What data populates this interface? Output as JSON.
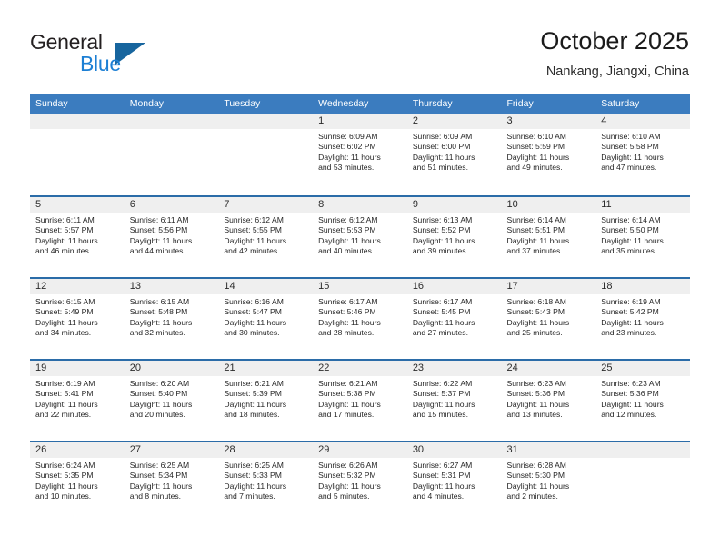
{
  "brand": {
    "name_part1": "General",
    "name_part2": "Blue"
  },
  "header": {
    "title": "October 2025",
    "subtitle": "Nankang, Jiangxi, China"
  },
  "colors": {
    "header_blue": "#3b7cbf",
    "row_divider_blue": "#2b6ca8",
    "daynum_band_gray": "#efefef",
    "brand_blue": "#1c7fd4",
    "brand_triangle": "#17659e"
  },
  "weekdays": [
    "Sunday",
    "Monday",
    "Tuesday",
    "Wednesday",
    "Thursday",
    "Friday",
    "Saturday"
  ],
  "weeks": [
    [
      {
        "day": "",
        "sunrise": "",
        "sunset": "",
        "daylight_line1": "",
        "daylight_line2": "",
        "empty": true
      },
      {
        "day": "",
        "sunrise": "",
        "sunset": "",
        "daylight_line1": "",
        "daylight_line2": "",
        "empty": true
      },
      {
        "day": "",
        "sunrise": "",
        "sunset": "",
        "daylight_line1": "",
        "daylight_line2": "",
        "empty": true
      },
      {
        "day": "1",
        "sunrise": "Sunrise: 6:09 AM",
        "sunset": "Sunset: 6:02 PM",
        "daylight_line1": "Daylight: 11 hours",
        "daylight_line2": "and 53 minutes.",
        "empty": false
      },
      {
        "day": "2",
        "sunrise": "Sunrise: 6:09 AM",
        "sunset": "Sunset: 6:00 PM",
        "daylight_line1": "Daylight: 11 hours",
        "daylight_line2": "and 51 minutes.",
        "empty": false
      },
      {
        "day": "3",
        "sunrise": "Sunrise: 6:10 AM",
        "sunset": "Sunset: 5:59 PM",
        "daylight_line1": "Daylight: 11 hours",
        "daylight_line2": "and 49 minutes.",
        "empty": false
      },
      {
        "day": "4",
        "sunrise": "Sunrise: 6:10 AM",
        "sunset": "Sunset: 5:58 PM",
        "daylight_line1": "Daylight: 11 hours",
        "daylight_line2": "and 47 minutes.",
        "empty": false
      }
    ],
    [
      {
        "day": "5",
        "sunrise": "Sunrise: 6:11 AM",
        "sunset": "Sunset: 5:57 PM",
        "daylight_line1": "Daylight: 11 hours",
        "daylight_line2": "and 46 minutes.",
        "empty": false
      },
      {
        "day": "6",
        "sunrise": "Sunrise: 6:11 AM",
        "sunset": "Sunset: 5:56 PM",
        "daylight_line1": "Daylight: 11 hours",
        "daylight_line2": "and 44 minutes.",
        "empty": false
      },
      {
        "day": "7",
        "sunrise": "Sunrise: 6:12 AM",
        "sunset": "Sunset: 5:55 PM",
        "daylight_line1": "Daylight: 11 hours",
        "daylight_line2": "and 42 minutes.",
        "empty": false
      },
      {
        "day": "8",
        "sunrise": "Sunrise: 6:12 AM",
        "sunset": "Sunset: 5:53 PM",
        "daylight_line1": "Daylight: 11 hours",
        "daylight_line2": "and 40 minutes.",
        "empty": false
      },
      {
        "day": "9",
        "sunrise": "Sunrise: 6:13 AM",
        "sunset": "Sunset: 5:52 PM",
        "daylight_line1": "Daylight: 11 hours",
        "daylight_line2": "and 39 minutes.",
        "empty": false
      },
      {
        "day": "10",
        "sunrise": "Sunrise: 6:14 AM",
        "sunset": "Sunset: 5:51 PM",
        "daylight_line1": "Daylight: 11 hours",
        "daylight_line2": "and 37 minutes.",
        "empty": false
      },
      {
        "day": "11",
        "sunrise": "Sunrise: 6:14 AM",
        "sunset": "Sunset: 5:50 PM",
        "daylight_line1": "Daylight: 11 hours",
        "daylight_line2": "and 35 minutes.",
        "empty": false
      }
    ],
    [
      {
        "day": "12",
        "sunrise": "Sunrise: 6:15 AM",
        "sunset": "Sunset: 5:49 PM",
        "daylight_line1": "Daylight: 11 hours",
        "daylight_line2": "and 34 minutes.",
        "empty": false
      },
      {
        "day": "13",
        "sunrise": "Sunrise: 6:15 AM",
        "sunset": "Sunset: 5:48 PM",
        "daylight_line1": "Daylight: 11 hours",
        "daylight_line2": "and 32 minutes.",
        "empty": false
      },
      {
        "day": "14",
        "sunrise": "Sunrise: 6:16 AM",
        "sunset": "Sunset: 5:47 PM",
        "daylight_line1": "Daylight: 11 hours",
        "daylight_line2": "and 30 minutes.",
        "empty": false
      },
      {
        "day": "15",
        "sunrise": "Sunrise: 6:17 AM",
        "sunset": "Sunset: 5:46 PM",
        "daylight_line1": "Daylight: 11 hours",
        "daylight_line2": "and 28 minutes.",
        "empty": false
      },
      {
        "day": "16",
        "sunrise": "Sunrise: 6:17 AM",
        "sunset": "Sunset: 5:45 PM",
        "daylight_line1": "Daylight: 11 hours",
        "daylight_line2": "and 27 minutes.",
        "empty": false
      },
      {
        "day": "17",
        "sunrise": "Sunrise: 6:18 AM",
        "sunset": "Sunset: 5:43 PM",
        "daylight_line1": "Daylight: 11 hours",
        "daylight_line2": "and 25 minutes.",
        "empty": false
      },
      {
        "day": "18",
        "sunrise": "Sunrise: 6:19 AM",
        "sunset": "Sunset: 5:42 PM",
        "daylight_line1": "Daylight: 11 hours",
        "daylight_line2": "and 23 minutes.",
        "empty": false
      }
    ],
    [
      {
        "day": "19",
        "sunrise": "Sunrise: 6:19 AM",
        "sunset": "Sunset: 5:41 PM",
        "daylight_line1": "Daylight: 11 hours",
        "daylight_line2": "and 22 minutes.",
        "empty": false
      },
      {
        "day": "20",
        "sunrise": "Sunrise: 6:20 AM",
        "sunset": "Sunset: 5:40 PM",
        "daylight_line1": "Daylight: 11 hours",
        "daylight_line2": "and 20 minutes.",
        "empty": false
      },
      {
        "day": "21",
        "sunrise": "Sunrise: 6:21 AM",
        "sunset": "Sunset: 5:39 PM",
        "daylight_line1": "Daylight: 11 hours",
        "daylight_line2": "and 18 minutes.",
        "empty": false
      },
      {
        "day": "22",
        "sunrise": "Sunrise: 6:21 AM",
        "sunset": "Sunset: 5:38 PM",
        "daylight_line1": "Daylight: 11 hours",
        "daylight_line2": "and 17 minutes.",
        "empty": false
      },
      {
        "day": "23",
        "sunrise": "Sunrise: 6:22 AM",
        "sunset": "Sunset: 5:37 PM",
        "daylight_line1": "Daylight: 11 hours",
        "daylight_line2": "and 15 minutes.",
        "empty": false
      },
      {
        "day": "24",
        "sunrise": "Sunrise: 6:23 AM",
        "sunset": "Sunset: 5:36 PM",
        "daylight_line1": "Daylight: 11 hours",
        "daylight_line2": "and 13 minutes.",
        "empty": false
      },
      {
        "day": "25",
        "sunrise": "Sunrise: 6:23 AM",
        "sunset": "Sunset: 5:36 PM",
        "daylight_line1": "Daylight: 11 hours",
        "daylight_line2": "and 12 minutes.",
        "empty": false
      }
    ],
    [
      {
        "day": "26",
        "sunrise": "Sunrise: 6:24 AM",
        "sunset": "Sunset: 5:35 PM",
        "daylight_line1": "Daylight: 11 hours",
        "daylight_line2": "and 10 minutes.",
        "empty": false
      },
      {
        "day": "27",
        "sunrise": "Sunrise: 6:25 AM",
        "sunset": "Sunset: 5:34 PM",
        "daylight_line1": "Daylight: 11 hours",
        "daylight_line2": "and 8 minutes.",
        "empty": false
      },
      {
        "day": "28",
        "sunrise": "Sunrise: 6:25 AM",
        "sunset": "Sunset: 5:33 PM",
        "daylight_line1": "Daylight: 11 hours",
        "daylight_line2": "and 7 minutes.",
        "empty": false
      },
      {
        "day": "29",
        "sunrise": "Sunrise: 6:26 AM",
        "sunset": "Sunset: 5:32 PM",
        "daylight_line1": "Daylight: 11 hours",
        "daylight_line2": "and 5 minutes.",
        "empty": false
      },
      {
        "day": "30",
        "sunrise": "Sunrise: 6:27 AM",
        "sunset": "Sunset: 5:31 PM",
        "daylight_line1": "Daylight: 11 hours",
        "daylight_line2": "and 4 minutes.",
        "empty": false
      },
      {
        "day": "31",
        "sunrise": "Sunrise: 6:28 AM",
        "sunset": "Sunset: 5:30 PM",
        "daylight_line1": "Daylight: 11 hours",
        "daylight_line2": "and 2 minutes.",
        "empty": false
      },
      {
        "day": "",
        "sunrise": "",
        "sunset": "",
        "daylight_line1": "",
        "daylight_line2": "",
        "empty": true
      }
    ]
  ]
}
